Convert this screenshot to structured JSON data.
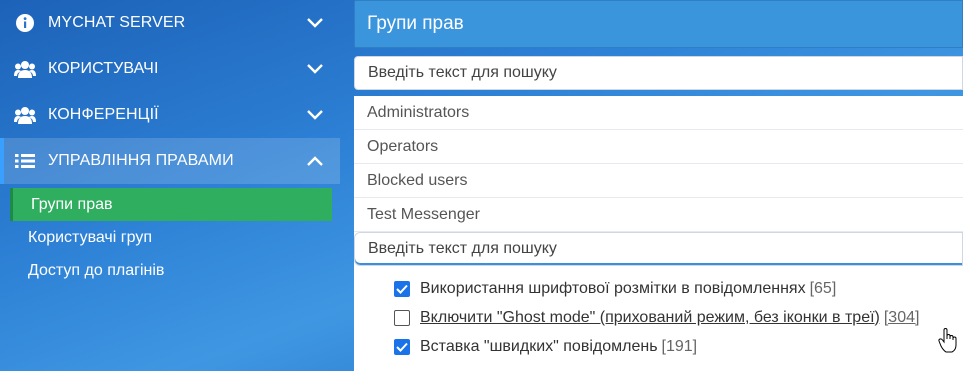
{
  "sidebar": {
    "items": [
      {
        "label": "MYCHAT SERVER",
        "icon": "info-icon",
        "expanded": false
      },
      {
        "label": "КОРИСТУВАЧІ",
        "icon": "users-icon",
        "expanded": false
      },
      {
        "label": "КОНФЕРЕНЦІЇ",
        "icon": "users-icon",
        "expanded": false
      },
      {
        "label": "УПРАВЛІННЯ ПРАВАМИ",
        "icon": "list-icon",
        "expanded": true
      }
    ],
    "subitems": [
      {
        "label": "Групи прав",
        "active": true
      },
      {
        "label": "Користувачі груп",
        "active": false
      },
      {
        "label": "Доступ до плагінів",
        "active": false
      }
    ]
  },
  "main": {
    "title": "Групи прав",
    "search_placeholder": "Введіть текст для пошуку",
    "groups": [
      "Administrators",
      "Operators",
      "Blocked users",
      "Test Messenger"
    ],
    "perm_search_placeholder": "Введіть текст для пошуку",
    "permissions": [
      {
        "label": "Використання шрифтової розмітки в повідомленнях",
        "count": "[65]",
        "checked": true
      },
      {
        "label": "Включити \"Ghost mode\" (прихований режим, без іконки в треї)",
        "count": "[304]",
        "checked": false
      },
      {
        "label": "Вставка \"швидких\" повідомлень",
        "count": "[191]",
        "checked": true
      }
    ]
  },
  "colors": {
    "header": "#3b95dd",
    "active_sub": "#2fae5f",
    "checkbox": "#1a73e8"
  }
}
